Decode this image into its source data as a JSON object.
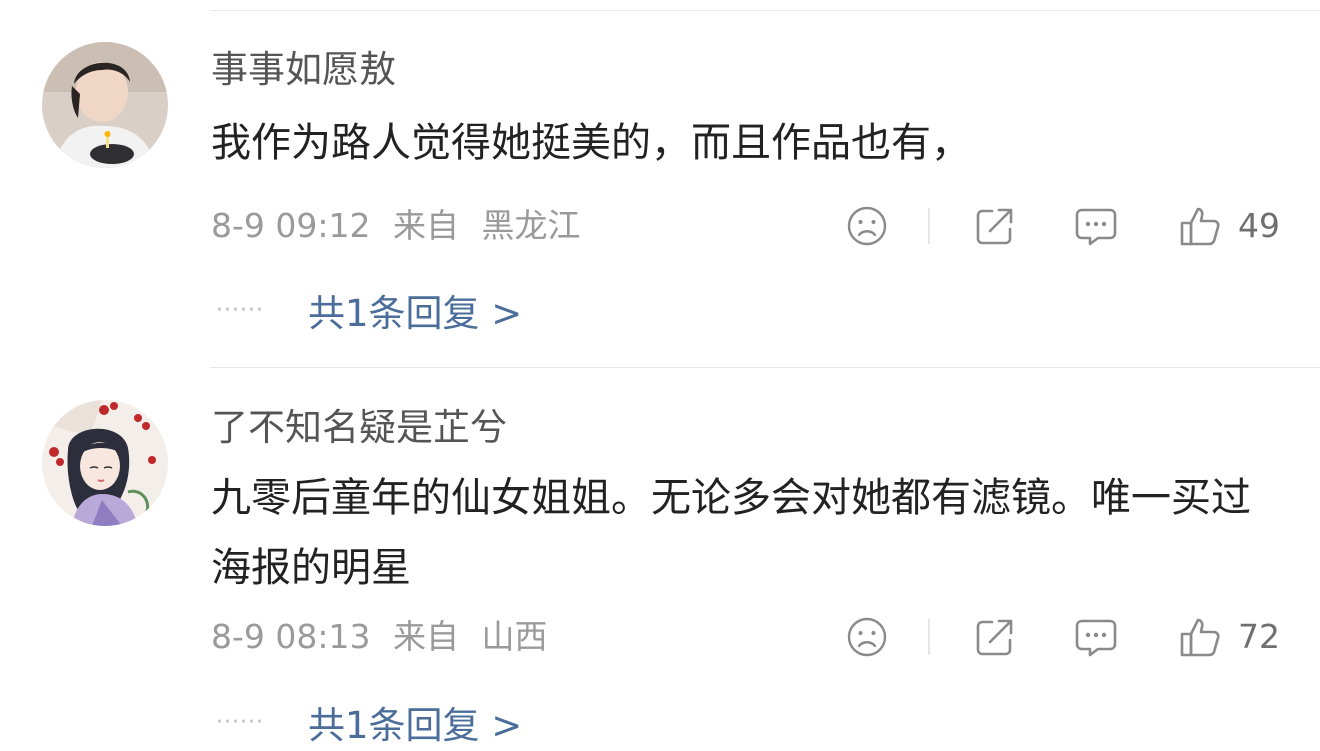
{
  "comments": [
    {
      "username": "事事如愿敖",
      "text": "我作为路人觉得她挺美的，而且作品也有，",
      "date": "8-9 09:12",
      "source_label": "来自",
      "location": "黑龙江",
      "likes": "49",
      "dots": "······",
      "replies_label": "共1条回复 >",
      "avatar_icon": "avatar-young-man-with-cake"
    },
    {
      "username": "了不知名疑是芷兮",
      "text": "九零后童年的仙女姐姐。无论多会对她都有滤镜。唯一买过海报的明星",
      "date": "8-9 08:13",
      "source_label": "来自",
      "location": "山西",
      "likes": "72",
      "dots": "······",
      "replies_label": "共1条回复 >",
      "avatar_icon": "avatar-illustrated-girl-with-berries"
    }
  ],
  "colors": {
    "username": "#555555",
    "text": "#222222",
    "meta": "#9a9a9a",
    "reply_link": "#4b6d9a",
    "icon": "#8a8a8a"
  }
}
